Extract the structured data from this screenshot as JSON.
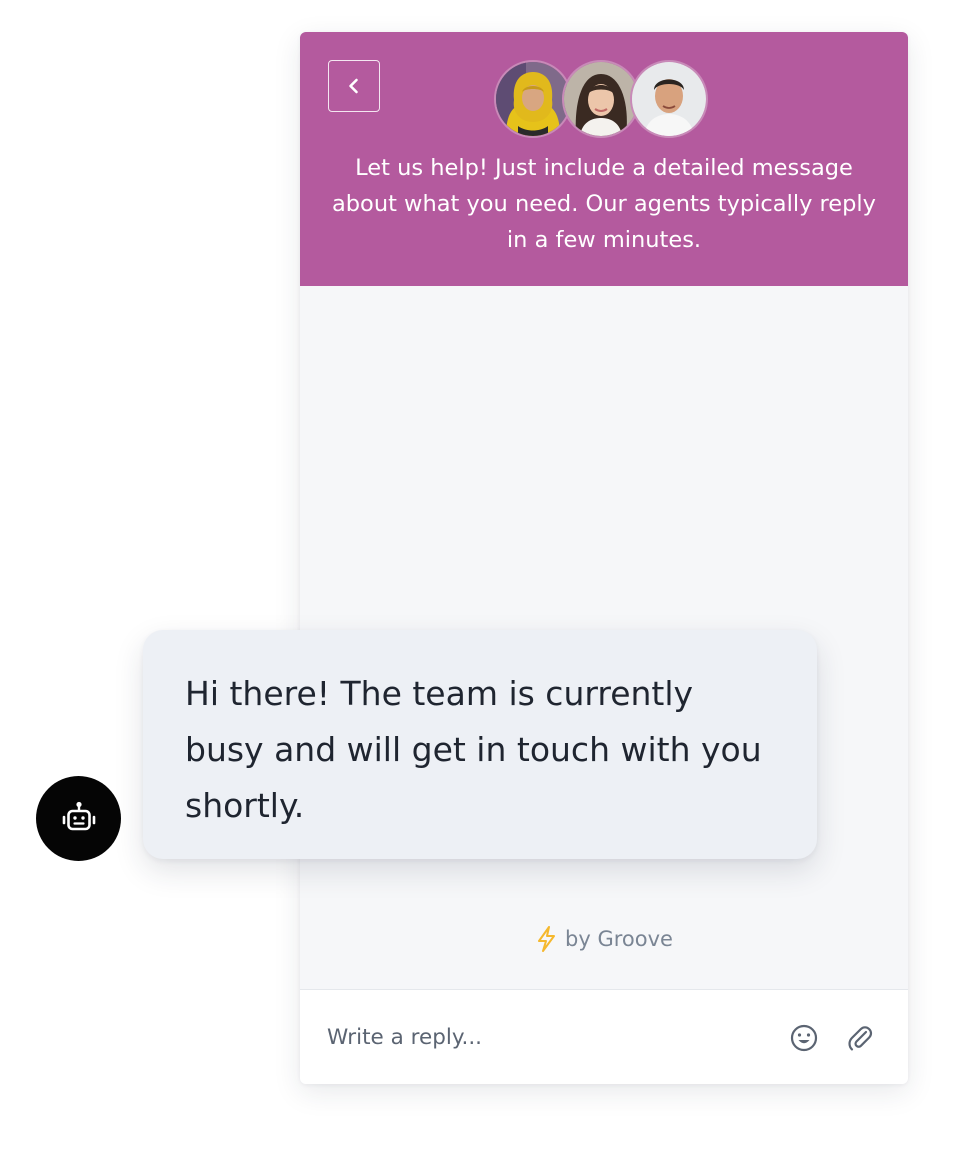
{
  "header": {
    "message": "Let us help! Just include a detailed message about what you need. Our agents typically reply in a few minutes.",
    "back_icon": "chevron-left-icon",
    "background_color": "#b45a9e",
    "agents": [
      {
        "avatar": "agent-avatar-1"
      },
      {
        "avatar": "agent-avatar-2"
      },
      {
        "avatar": "agent-avatar-3"
      }
    ]
  },
  "bot_message": {
    "text": "Hi there! The team is currently busy and will get in touch with you shortly.",
    "avatar_icon": "robot-icon"
  },
  "branding": {
    "text": "by Groove",
    "icon": "lightning-icon",
    "icon_color": "#f5b82e"
  },
  "composer": {
    "placeholder": "Write a reply...",
    "emoji_icon": "emoji-icon",
    "attach_icon": "paperclip-icon"
  }
}
